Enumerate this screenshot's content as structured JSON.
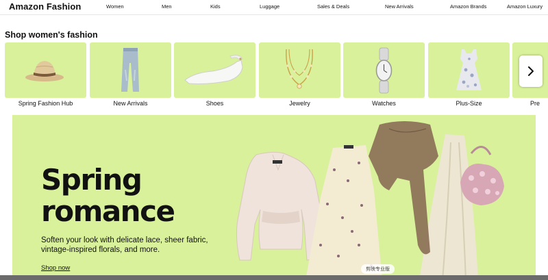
{
  "header": {
    "brand": "Amazon Fashion",
    "nav": [
      "Women",
      "Men",
      "Kids",
      "Luggage",
      "Sales & Deals",
      "New Arrivals",
      "Amazon Brands",
      "Amazon Luxury"
    ]
  },
  "section": {
    "title": "Shop women's fashion"
  },
  "categories": [
    {
      "label": "Spring Fashion Hub",
      "icon": "sun-hat-icon"
    },
    {
      "label": "New Arrivals",
      "icon": "jeans-icon"
    },
    {
      "label": "Shoes",
      "icon": "flat-shoe-icon"
    },
    {
      "label": "Jewelry",
      "icon": "necklace-icon"
    },
    {
      "label": "Watches",
      "icon": "watch-icon"
    },
    {
      "label": "Plus-Size",
      "icon": "dress-icon"
    },
    {
      "label": "Pre",
      "icon": "partial-tile"
    }
  ],
  "carousel": {
    "next_icon": "chevron-right-icon"
  },
  "hero": {
    "title_line1": "Spring",
    "title_line2": "romance",
    "subtitle": "Soften your look with delicate lace, sheer fabric, vintage-inspired florals, and more.",
    "cta": "Shop now"
  },
  "watermark": "剪映专业版",
  "colors": {
    "tile_bg": "#d8f19a",
    "hero_bg": "#d8f19a",
    "text": "#0f1111"
  }
}
